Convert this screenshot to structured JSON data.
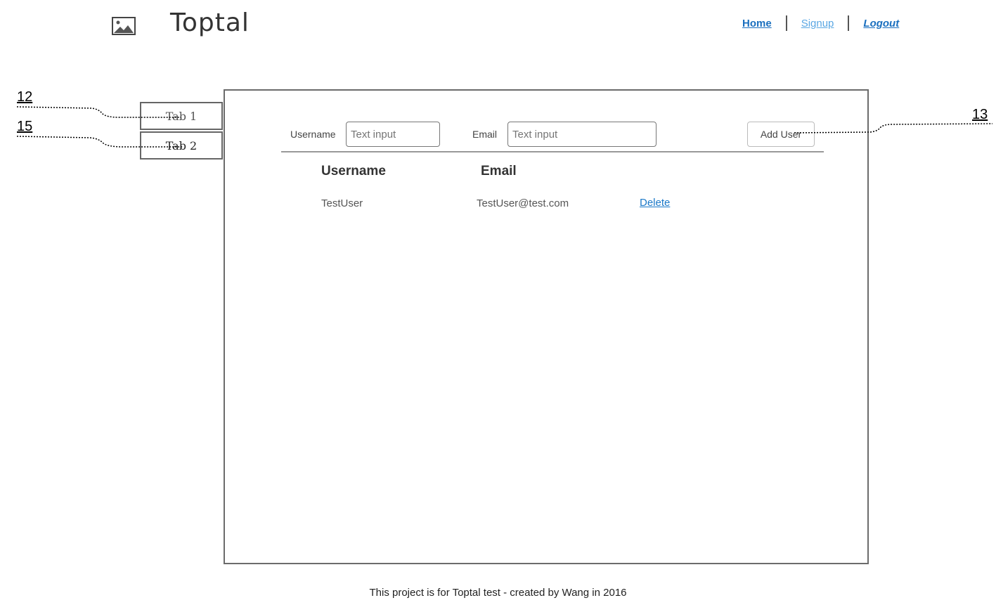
{
  "header": {
    "brand": "Toptal",
    "logo_icon": "image-placeholder-icon",
    "nav": {
      "home": "Home",
      "signup": "Signup",
      "logout": "Logout"
    }
  },
  "tabs": [
    {
      "label": "Tab 1"
    },
    {
      "label": "Tab 2"
    }
  ],
  "form": {
    "username_label": "Username",
    "username_placeholder": "Text input",
    "email_label": "Email",
    "email_placeholder": "Text input",
    "add_button": "Add User"
  },
  "table": {
    "headers": [
      "Username",
      "Email"
    ],
    "rows": [
      {
        "username": "TestUser",
        "email": "TestUser@test.com",
        "action": "Delete"
      }
    ]
  },
  "callouts": {
    "c12": "12",
    "c15": "15",
    "c13": "13"
  },
  "footer": "This project is for Toptal test - created by Wang in 2016",
  "colors": {
    "link": "#1a6fbf",
    "link_light": "#5aa7e3",
    "border": "#6b6b6b"
  }
}
